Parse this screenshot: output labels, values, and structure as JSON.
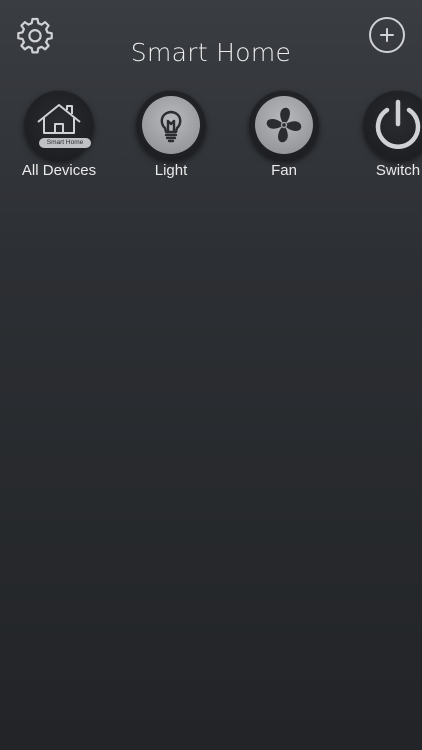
{
  "header": {
    "title": "Smart Home"
  },
  "categories": [
    {
      "id": "all-devices",
      "label": "All Devices",
      "badge": "Smart Home",
      "icon": "house-icon"
    },
    {
      "id": "light",
      "label": "Light",
      "icon": "lightbulb-icon"
    },
    {
      "id": "fan",
      "label": "Fan",
      "icon": "fan-icon"
    },
    {
      "id": "switch",
      "label": "Switch",
      "icon": "power-icon"
    }
  ],
  "icons": {
    "settings": "gear-icon",
    "add": "plus-icon"
  },
  "colors": {
    "background_top": "#3a3d42",
    "background_bottom": "#222427",
    "icon_light": "#cfd1d4",
    "icon_disc_grey": "#9c9ea2"
  }
}
